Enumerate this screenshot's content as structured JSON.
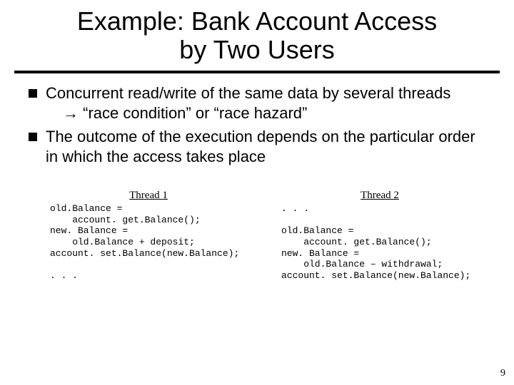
{
  "title_line1": "Example:  Bank Account Access",
  "title_line2": "by Two Users",
  "bullets": {
    "b1_main": "Concurrent read/write of the same data by several threads",
    "b1_sub": "→ “race condition” or “race hazard”",
    "b2_main": "The outcome of the execution depends on the particular order in which the access takes place"
  },
  "threads": {
    "t1": {
      "header": "Thread 1",
      "code": "old.Balance =\n    account. get.Balance();\nnew. Balance =\n    old.Balance + deposit;\naccount. set.Balance(new.Balance);\n\n. . ."
    },
    "t2": {
      "header": "Thread 2",
      "code": ". . .\n\nold.Balance =\n    account. get.Balance();\nnew. Balance =\n    old.Balance – withdrawal;\naccount. set.Balance(new.Balance);"
    }
  },
  "page_number": "9"
}
